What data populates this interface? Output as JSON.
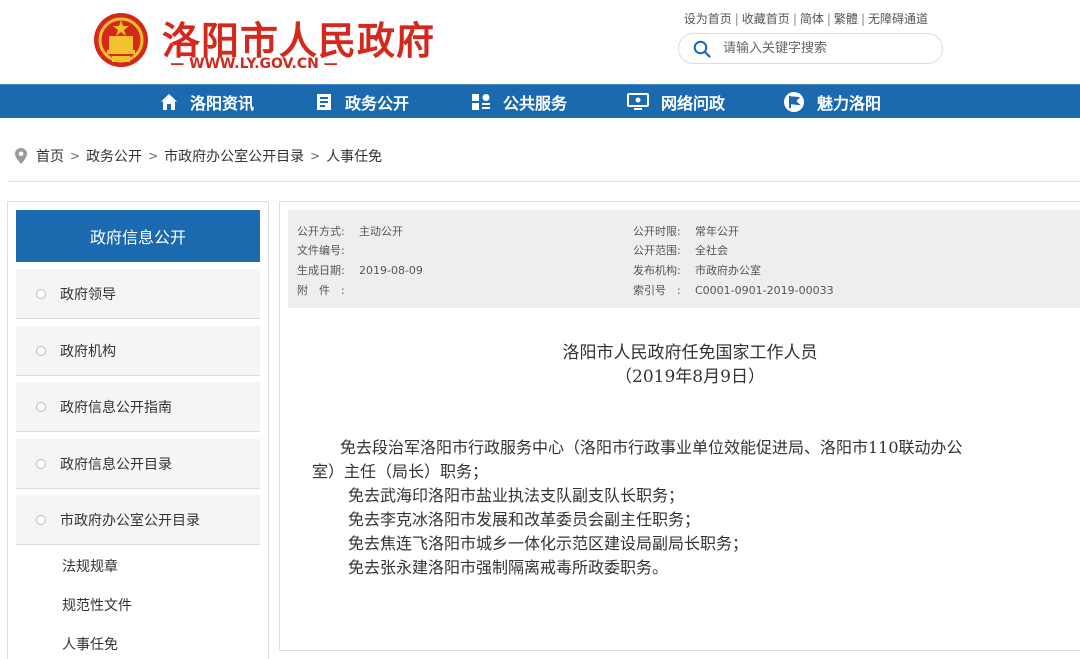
{
  "header": {
    "site_title": "洛阳市人民政府",
    "site_url": "— WWW.LY.GOV.CN —",
    "top_links": [
      "设为首页",
      "收藏首页",
      "简体",
      "繁體",
      "无障碍通道"
    ],
    "top_link_separator": "|",
    "search_placeholder": "请输入关键字搜索"
  },
  "nav": {
    "items": [
      {
        "label": "洛阳资讯",
        "icon": "home-icon"
      },
      {
        "label": "政务公开",
        "icon": "document-icon"
      },
      {
        "label": "公共服务",
        "icon": "grid-icon"
      },
      {
        "label": "网络问政",
        "icon": "monitor-icon"
      },
      {
        "label": "魅力洛阳",
        "icon": "flag-icon"
      }
    ]
  },
  "breadcrumb": {
    "items": [
      "首页",
      "政务公开",
      "市政府办公室公开目录",
      "人事任免"
    ],
    "separator": ">"
  },
  "sidebar": {
    "title": "政府信息公开",
    "items": [
      "政府领导",
      "政府机构",
      "政府信息公开指南",
      "政府信息公开目录",
      "市政府办公室公开目录"
    ],
    "sub_items": [
      "法规规章",
      "规范性文件",
      "人事任免"
    ]
  },
  "meta": {
    "left": [
      {
        "label": "公开方式:",
        "value": "主动公开"
      },
      {
        "label": "文件编号:",
        "value": ""
      },
      {
        "label": "生成日期:",
        "value": "2019-08-09"
      },
      {
        "label": "附　件　:",
        "value": ""
      }
    ],
    "right": [
      {
        "label": "公开时限:",
        "value": "常年公开"
      },
      {
        "label": "公开范围:",
        "value": "全社会"
      },
      {
        "label": "发布机构:",
        "value": "市政府办公室"
      },
      {
        "label": "索引号　:",
        "value": "C0001-0901-2019-00033"
      }
    ]
  },
  "document": {
    "title": "洛阳市人民政府任免国家工作人员",
    "date": "（2019年8月9日）",
    "lines": [
      "免去段治军洛阳市行政服务中心（洛阳市行政事业单位效能促进局、洛阳市110联动办公",
      "室）主任（局长）职务；",
      "免去武海印洛阳市盐业执法支队副支队长职务；",
      "免去李克冰洛阳市发展和改革委员会副主任职务；",
      "免去焦连飞洛阳市城乡一体化示范区建设局副局长职务；",
      "免去张永建洛阳市强制隔离戒毒所政委职务。"
    ]
  },
  "colors": {
    "brand_red": "#d4281c",
    "nav_blue": "#1b6ab0",
    "meta_bg": "#eeeeee"
  }
}
